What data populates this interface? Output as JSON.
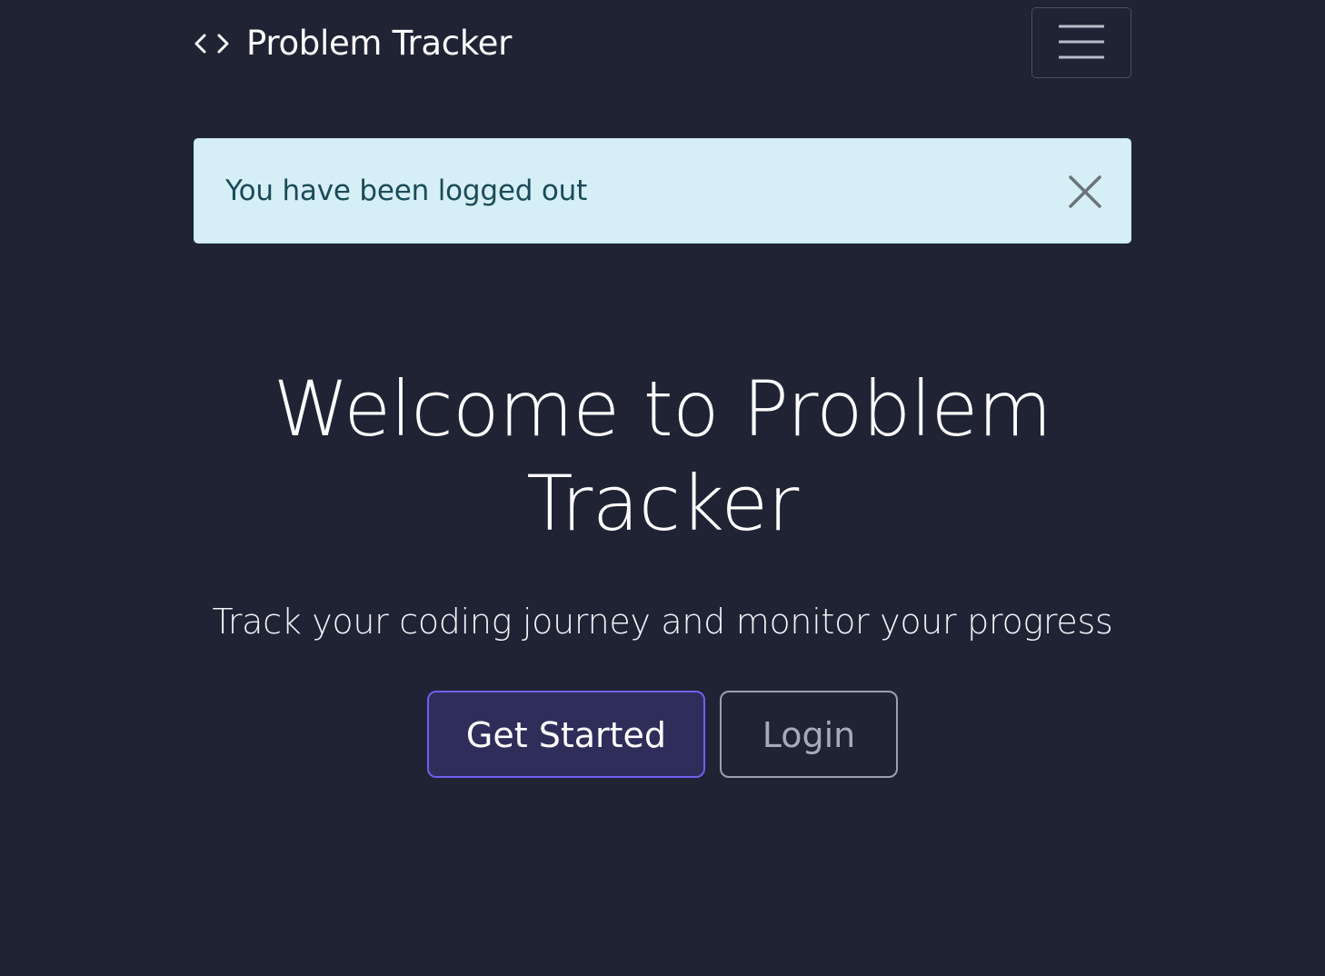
{
  "navbar": {
    "brand_icon": "code-icon",
    "brand_text": "Problem Tracker",
    "menu_icon": "hamburger-menu-icon"
  },
  "alert": {
    "message": "You have been logged out",
    "close_icon": "close-icon",
    "background_color": "#d6eff6",
    "text_color": "#1b4b59"
  },
  "hero": {
    "title": "Welcome to Problem Tracker",
    "subtitle": "Track your coding journey and monitor your progress",
    "primary_button": "Get Started",
    "secondary_button": "Login"
  },
  "colors": {
    "background": "#1f2334",
    "primary_button_bg": "#2f2d5a",
    "primary_button_border": "#6f5ff0",
    "secondary_button_border": "#9ca0ae"
  }
}
